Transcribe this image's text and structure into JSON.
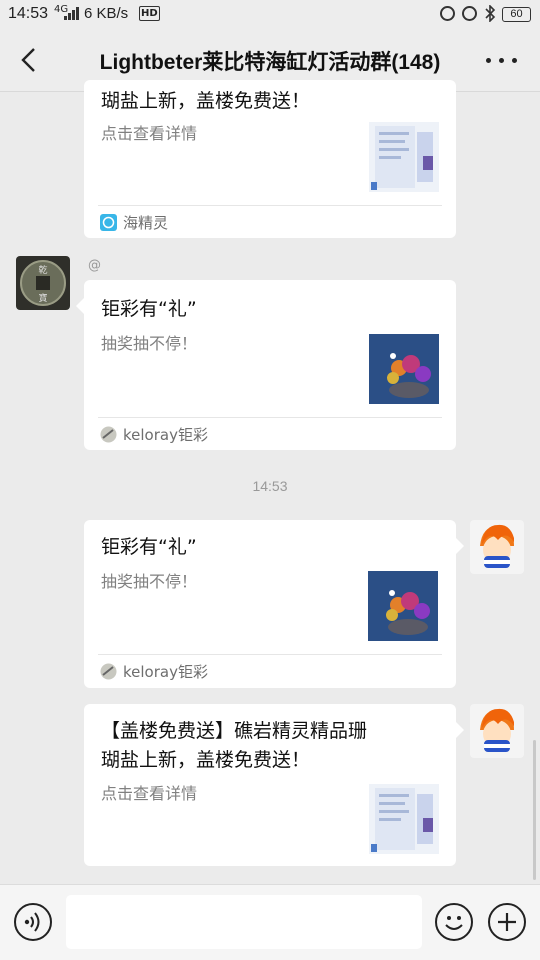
{
  "status_bar": {
    "time": "14:53",
    "network": "4G",
    "speed": "6 KB/s",
    "hd": "HD",
    "battery": "60"
  },
  "header": {
    "title": "Lightbeter莱比特海缸灯活动群(148)"
  },
  "messages": [
    {
      "title": "瑚盐上新，盖楼免费送！",
      "desc": "点击查看详情",
      "source": "海精灵"
    },
    {
      "sender": "@",
      "title": "钜彩有“礼”",
      "desc": "抽奖抽不停！",
      "source": "keloray钜彩"
    },
    {
      "timestamp": "14:53"
    },
    {
      "title": "钜彩有“礼”",
      "desc": "抽奖抽不停！",
      "source": "keloray钜彩"
    },
    {
      "title_line1": "【盖楼免费送】礁岩精灵精品珊",
      "title_line2": "瑚盐上新，盖楼免费送！",
      "desc": "点击查看详情"
    }
  ],
  "icons": {
    "back": "chevron-left-icon",
    "more": "more-dots-icon",
    "voice": "voice-icon",
    "emoji": "emoji-icon",
    "plus": "plus-icon"
  },
  "colors": {
    "background": "#ebebeb",
    "card": "#ffffff",
    "mini_program": "#38b6e8"
  }
}
